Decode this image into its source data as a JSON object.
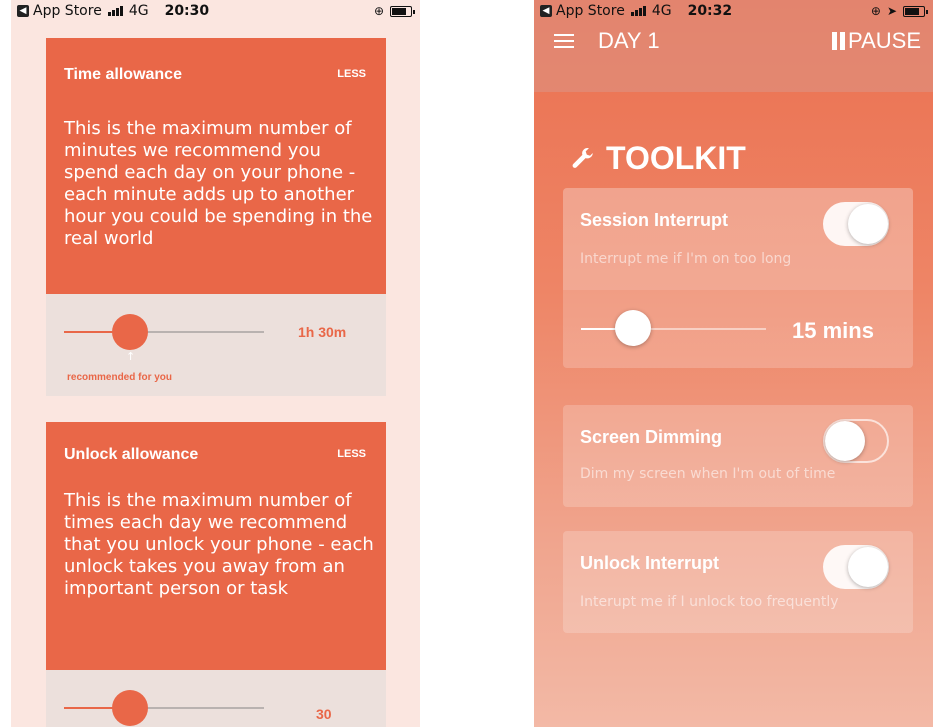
{
  "left_screen": {
    "status": {
      "carrier": "App Store",
      "network": "4G",
      "time": "20:30"
    },
    "time_card": {
      "title": "Time allowance",
      "toggle_label": "LESS",
      "description": "This is the maximum number of minutes we recommend you spend each day on your phone - each minute adds up to another hour you could be spending in the real world",
      "value": "1h 30m",
      "recommended_label": "recommended for you"
    },
    "unlock_card": {
      "title": "Unlock allowance",
      "toggle_label": "LESS",
      "description": "This is the maximum number of times each day we recommend that you unlock your phone - each unlock takes you away from an important person or task",
      "value": "30"
    }
  },
  "right_screen": {
    "status": {
      "carrier": "App Store",
      "network": "4G",
      "time": "20:32"
    },
    "nav": {
      "title": "DAY 1",
      "pause_label": "PAUSE"
    },
    "toolkit_title": "TOOLKIT",
    "items": [
      {
        "name": "Session Interrupt",
        "description": "Interrupt me if I'm on too long",
        "enabled": true,
        "slider_value": "15 mins"
      },
      {
        "name": "Screen Dimming",
        "description": "Dim my screen when I'm out of time",
        "enabled": false
      },
      {
        "name": "Unlock Interrupt",
        "description": "Interupt me if I unlock too frequently",
        "enabled": true
      }
    ]
  },
  "colors": {
    "accent": "#e96748",
    "left_background": "#fbe6e0",
    "slider_panel": "#ece0dc"
  }
}
